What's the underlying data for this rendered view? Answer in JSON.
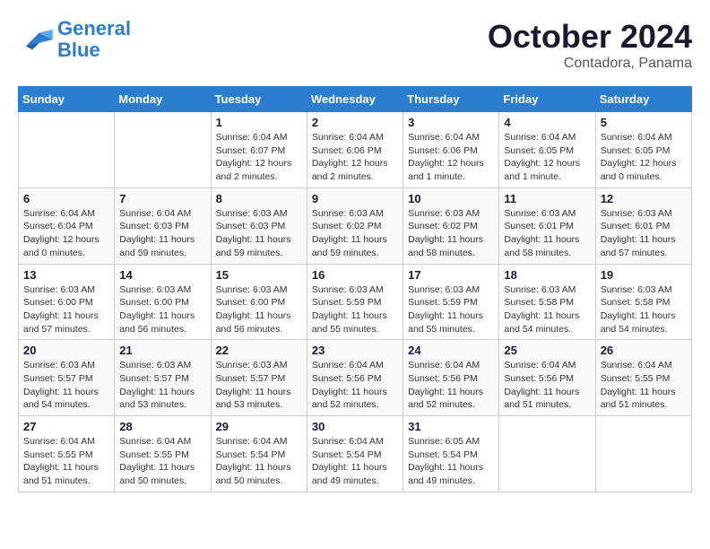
{
  "logo": {
    "text_general": "General",
    "text_blue": "Blue"
  },
  "header": {
    "month": "October 2024",
    "location": "Contadora, Panama"
  },
  "weekdays": [
    "Sunday",
    "Monday",
    "Tuesday",
    "Wednesday",
    "Thursday",
    "Friday",
    "Saturday"
  ],
  "weeks": [
    [
      {
        "day": "",
        "info": ""
      },
      {
        "day": "",
        "info": ""
      },
      {
        "day": "1",
        "info": "Sunrise: 6:04 AM\nSunset: 6:07 PM\nDaylight: 12 hours\nand 2 minutes."
      },
      {
        "day": "2",
        "info": "Sunrise: 6:04 AM\nSunset: 6:06 PM\nDaylight: 12 hours\nand 2 minutes."
      },
      {
        "day": "3",
        "info": "Sunrise: 6:04 AM\nSunset: 6:06 PM\nDaylight: 12 hours\nand 1 minute."
      },
      {
        "day": "4",
        "info": "Sunrise: 6:04 AM\nSunset: 6:05 PM\nDaylight: 12 hours\nand 1 minute."
      },
      {
        "day": "5",
        "info": "Sunrise: 6:04 AM\nSunset: 6:05 PM\nDaylight: 12 hours\nand 0 minutes."
      }
    ],
    [
      {
        "day": "6",
        "info": "Sunrise: 6:04 AM\nSunset: 6:04 PM\nDaylight: 12 hours\nand 0 minutes."
      },
      {
        "day": "7",
        "info": "Sunrise: 6:04 AM\nSunset: 6:03 PM\nDaylight: 11 hours\nand 59 minutes."
      },
      {
        "day": "8",
        "info": "Sunrise: 6:03 AM\nSunset: 6:03 PM\nDaylight: 11 hours\nand 59 minutes."
      },
      {
        "day": "9",
        "info": "Sunrise: 6:03 AM\nSunset: 6:02 PM\nDaylight: 11 hours\nand 59 minutes."
      },
      {
        "day": "10",
        "info": "Sunrise: 6:03 AM\nSunset: 6:02 PM\nDaylight: 11 hours\nand 58 minutes."
      },
      {
        "day": "11",
        "info": "Sunrise: 6:03 AM\nSunset: 6:01 PM\nDaylight: 11 hours\nand 58 minutes."
      },
      {
        "day": "12",
        "info": "Sunrise: 6:03 AM\nSunset: 6:01 PM\nDaylight: 11 hours\nand 57 minutes."
      }
    ],
    [
      {
        "day": "13",
        "info": "Sunrise: 6:03 AM\nSunset: 6:00 PM\nDaylight: 11 hours\nand 57 minutes."
      },
      {
        "day": "14",
        "info": "Sunrise: 6:03 AM\nSunset: 6:00 PM\nDaylight: 11 hours\nand 56 minutes."
      },
      {
        "day": "15",
        "info": "Sunrise: 6:03 AM\nSunset: 6:00 PM\nDaylight: 11 hours\nand 56 minutes."
      },
      {
        "day": "16",
        "info": "Sunrise: 6:03 AM\nSunset: 5:59 PM\nDaylight: 11 hours\nand 55 minutes."
      },
      {
        "day": "17",
        "info": "Sunrise: 6:03 AM\nSunset: 5:59 PM\nDaylight: 11 hours\nand 55 minutes."
      },
      {
        "day": "18",
        "info": "Sunrise: 6:03 AM\nSunset: 5:58 PM\nDaylight: 11 hours\nand 54 minutes."
      },
      {
        "day": "19",
        "info": "Sunrise: 6:03 AM\nSunset: 5:58 PM\nDaylight: 11 hours\nand 54 minutes."
      }
    ],
    [
      {
        "day": "20",
        "info": "Sunrise: 6:03 AM\nSunset: 5:57 PM\nDaylight: 11 hours\nand 54 minutes."
      },
      {
        "day": "21",
        "info": "Sunrise: 6:03 AM\nSunset: 5:57 PM\nDaylight: 11 hours\nand 53 minutes."
      },
      {
        "day": "22",
        "info": "Sunrise: 6:03 AM\nSunset: 5:57 PM\nDaylight: 11 hours\nand 53 minutes."
      },
      {
        "day": "23",
        "info": "Sunrise: 6:04 AM\nSunset: 5:56 PM\nDaylight: 11 hours\nand 52 minutes."
      },
      {
        "day": "24",
        "info": "Sunrise: 6:04 AM\nSunset: 5:56 PM\nDaylight: 11 hours\nand 52 minutes."
      },
      {
        "day": "25",
        "info": "Sunrise: 6:04 AM\nSunset: 5:56 PM\nDaylight: 11 hours\nand 51 minutes."
      },
      {
        "day": "26",
        "info": "Sunrise: 6:04 AM\nSunset: 5:55 PM\nDaylight: 11 hours\nand 51 minutes."
      }
    ],
    [
      {
        "day": "27",
        "info": "Sunrise: 6:04 AM\nSunset: 5:55 PM\nDaylight: 11 hours\nand 51 minutes."
      },
      {
        "day": "28",
        "info": "Sunrise: 6:04 AM\nSunset: 5:55 PM\nDaylight: 11 hours\nand 50 minutes."
      },
      {
        "day": "29",
        "info": "Sunrise: 6:04 AM\nSunset: 5:54 PM\nDaylight: 11 hours\nand 50 minutes."
      },
      {
        "day": "30",
        "info": "Sunrise: 6:04 AM\nSunset: 5:54 PM\nDaylight: 11 hours\nand 49 minutes."
      },
      {
        "day": "31",
        "info": "Sunrise: 6:05 AM\nSunset: 5:54 PM\nDaylight: 11 hours\nand 49 minutes."
      },
      {
        "day": "",
        "info": ""
      },
      {
        "day": "",
        "info": ""
      }
    ]
  ]
}
